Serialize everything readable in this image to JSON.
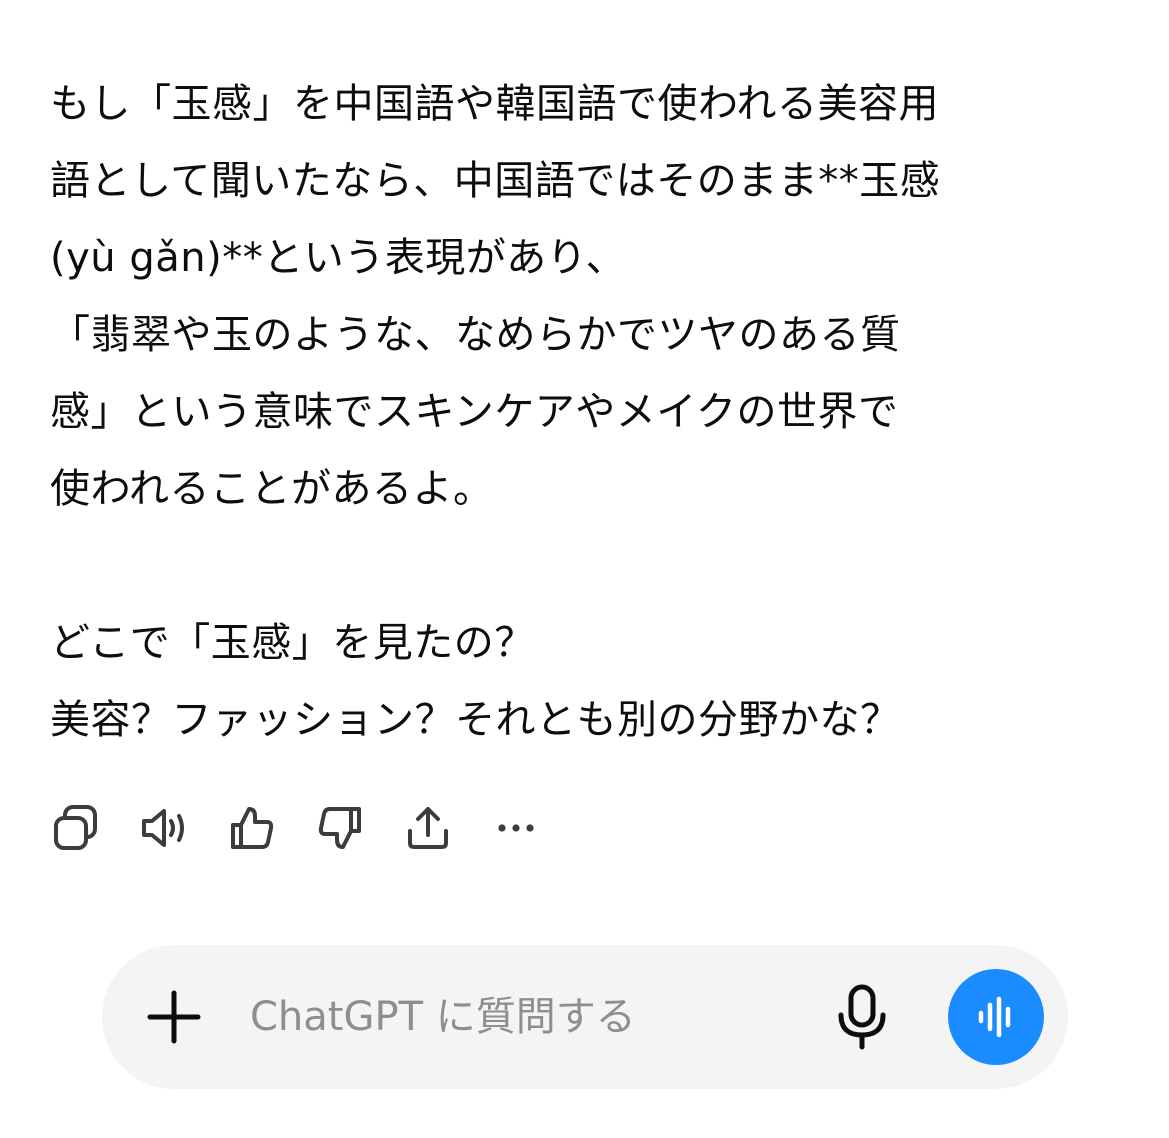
{
  "message": {
    "lines": [
      "もし「玉感」を中国語や韓国語で使われる美容用",
      "語として聞いたなら、中国語ではそのまま**玉感",
      "(yù gǎn)**という表現があり、",
      "「翡翠や玉のような、なめらかでツヤのある質",
      "感」という意味でスキンケアやメイクの世界で",
      "使われることがあるよ。",
      "",
      "どこで「玉感」を見たの？",
      "美容？ファッション？それとも別の分野かな？"
    ]
  },
  "actions": {
    "icons": [
      "copy-icon",
      "speaker-icon",
      "thumbs-up-icon",
      "thumbs-down-icon",
      "share-icon",
      "more-icon"
    ]
  },
  "composer": {
    "placeholder": "ChatGPT に質問する",
    "value": "",
    "accent_color": "#1a8cff"
  }
}
